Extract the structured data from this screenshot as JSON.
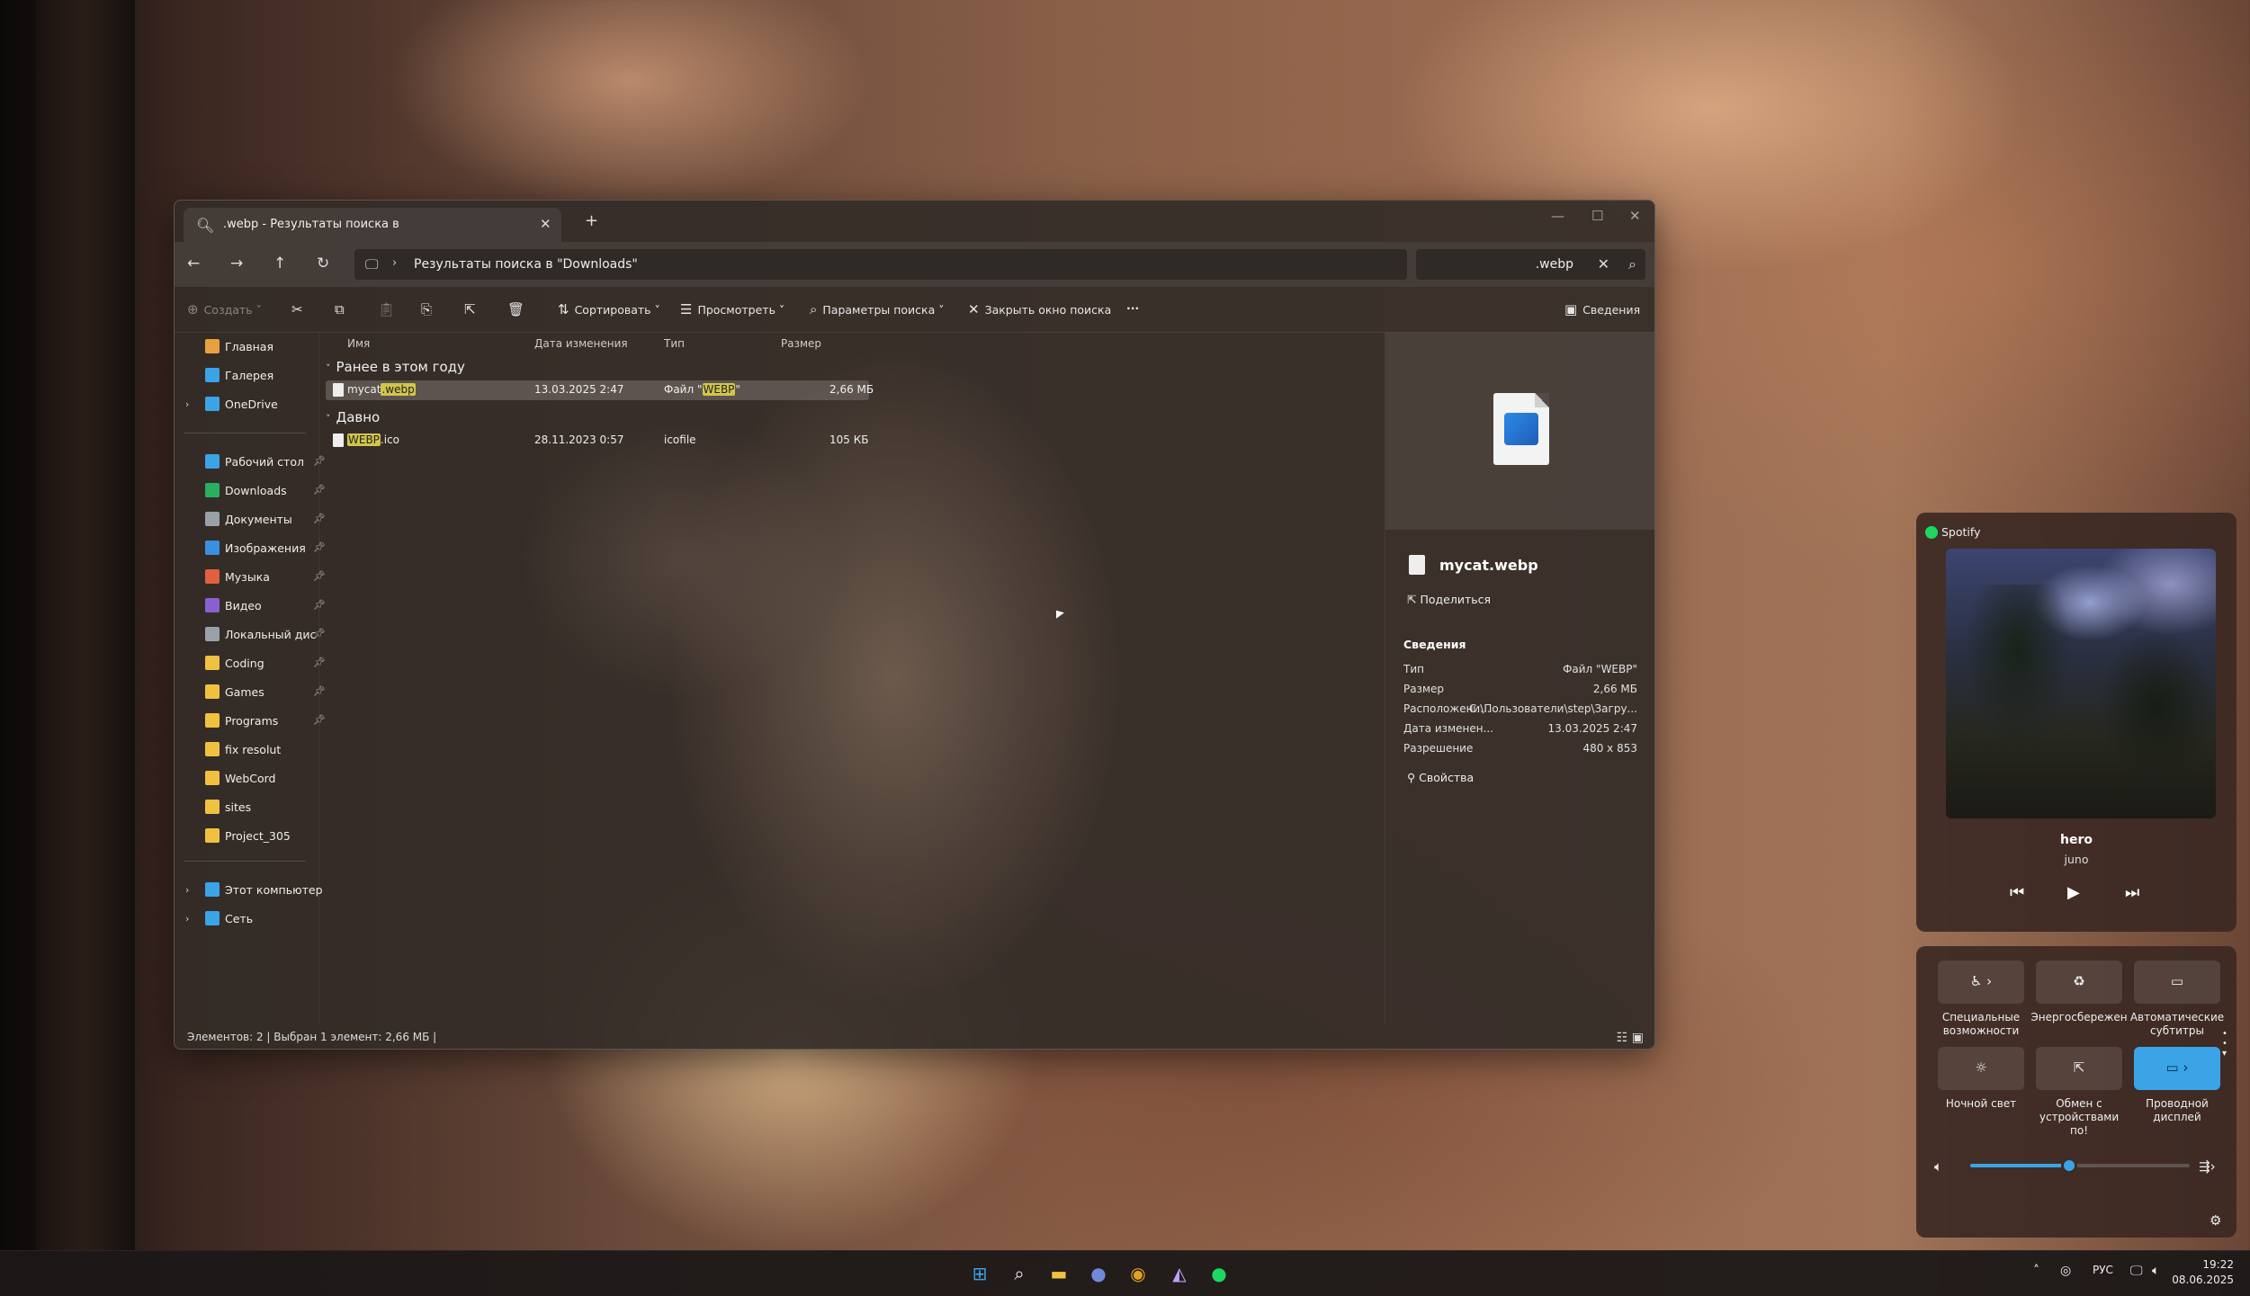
{
  "colors": {
    "accent": "#3aa4e6",
    "search_highlight": "#d2c64a",
    "spotify": "#1ed760"
  },
  "explorer": {
    "tab_title": ".webp - Результаты поиска в",
    "breadcrumb": "Результаты поиска в \"Downloads\"",
    "search_query": ".webp",
    "toolbar": {
      "create": "Создать",
      "sort": "Сортировать",
      "view": "Просмотреть",
      "search_options": "Параметры поиска",
      "close_search": "Закрыть окно поиска",
      "more": "···",
      "details": "Сведения"
    },
    "sidebar": {
      "top": [
        {
          "label": "Главная",
          "icon": "home-icon"
        },
        {
          "label": "Галерея",
          "icon": "gallery-icon"
        },
        {
          "label": "OneDrive",
          "icon": "cloud-icon"
        }
      ],
      "pinned": [
        {
          "label": "Рабочий стол",
          "icon": "desktop-icon"
        },
        {
          "label": "Downloads",
          "icon": "download-icon"
        },
        {
          "label": "Документы",
          "icon": "document-icon"
        },
        {
          "label": "Изображения",
          "icon": "pictures-icon"
        },
        {
          "label": "Музыка",
          "icon": "music-icon"
        },
        {
          "label": "Видео",
          "icon": "video-icon"
        },
        {
          "label": "Локальный дис",
          "icon": "drive-icon"
        },
        {
          "label": "Coding",
          "icon": "folder-icon"
        },
        {
          "label": "Games",
          "icon": "folder-icon"
        },
        {
          "label": "Programs",
          "icon": "folder-icon"
        },
        {
          "label": "fix resolut",
          "icon": "folder-icon"
        },
        {
          "label": "WebCord",
          "icon": "folder-icon"
        },
        {
          "label": "sites",
          "icon": "folder-icon"
        },
        {
          "label": "Project_305",
          "icon": "folder-icon"
        }
      ],
      "bottom": [
        {
          "label": "Этот компьютер",
          "icon": "computer-icon"
        },
        {
          "label": "Сеть",
          "icon": "network-icon"
        }
      ]
    },
    "columns": {
      "name": "Имя",
      "modified": "Дата изменения",
      "type": "Тип",
      "size": "Размер"
    },
    "groups": [
      {
        "label": "Ранее в этом году",
        "files": [
          {
            "name_pre": "mycat",
            "name_hl": ".webp",
            "name_post": "",
            "modified": "13.03.2025 2:47",
            "type_pre": "Файл \"",
            "type_hl": "WEBP",
            "type_post": "\"",
            "size": "2,66 МБ",
            "selected": true
          }
        ]
      },
      {
        "label": "Давно",
        "files": [
          {
            "name_pre": "",
            "name_hl": "WEBP",
            "name_post": ".ico",
            "modified": "28.11.2023 0:57",
            "type_pre": "icofile",
            "type_hl": "",
            "type_post": "",
            "size": "105 КБ",
            "selected": false
          }
        ]
      }
    ],
    "details": {
      "file_name": "mycat.webp",
      "share": "Поделиться",
      "section": "Сведения",
      "props": [
        {
          "key": "Тип",
          "value": "Файл \"WEBP\""
        },
        {
          "key": "Размер",
          "value": "2,66 МБ"
        },
        {
          "key": "Расположени...",
          "value": "C:\\Пользователи\\step\\Загру..."
        },
        {
          "key": "Дата изменен...",
          "value": "13.03.2025 2:47"
        },
        {
          "key": "Разрешение",
          "value": "480 x 853"
        }
      ],
      "properties_button": "Свойства"
    },
    "status": "Элементов: 2   |   Выбран 1 элемент: 2,66 МБ   |"
  },
  "media": {
    "app": "Spotify",
    "song": "hero",
    "artist": "juno"
  },
  "quick_settings": {
    "tiles": [
      {
        "label": "Специальные возможности",
        "icon": "accessibility-icon",
        "on": false
      },
      {
        "label": "Энергосбережен",
        "icon": "battery-saver-icon",
        "on": false
      },
      {
        "label": "Автоматические субтитры",
        "icon": "captions-icon",
        "on": false
      },
      {
        "label": "Ночной свет",
        "icon": "night-light-icon",
        "on": false
      },
      {
        "label": "Обмен с устройствами по!",
        "icon": "share-icon",
        "on": false
      },
      {
        "label": "Проводной дисплей",
        "icon": "cast-icon",
        "on": true
      }
    ],
    "volume": 0.45
  },
  "taskbar": {
    "lang": "РУС",
    "time": "19:22",
    "date": "08.06.2025"
  }
}
